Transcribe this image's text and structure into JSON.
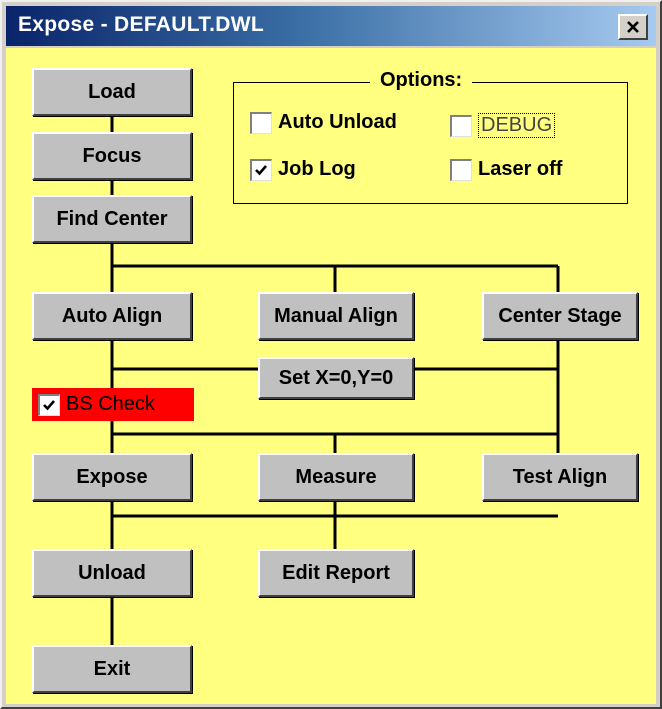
{
  "window": {
    "title": "Expose - DEFAULT.DWL",
    "close_icon": "close-icon",
    "client_color": "#ffff80",
    "title_gradient": [
      "#0a246a",
      "#a6caf0"
    ]
  },
  "buttons": {
    "load": "Load",
    "focus": "Focus",
    "find_center": "Find Center",
    "auto_align": "Auto Align",
    "manual_align": "Manual Align",
    "center_stage": "Center Stage",
    "set_xy": "Set X=0,Y=0",
    "expose": "Expose",
    "measure": "Measure",
    "test_align": "Test Align",
    "unload": "Unload",
    "edit_report": "Edit Report",
    "exit": "Exit"
  },
  "options": {
    "title": "Options:",
    "auto_unload": {
      "label": "Auto Unload",
      "checked": false
    },
    "debug": {
      "label": "DEBUG",
      "checked": false
    },
    "job_log": {
      "label": "Job Log",
      "checked": true
    },
    "laser_off": {
      "label": "Laser off",
      "checked": false
    }
  },
  "bs_check": {
    "label": "BS Check",
    "checked": true,
    "color": "#ff0000"
  }
}
